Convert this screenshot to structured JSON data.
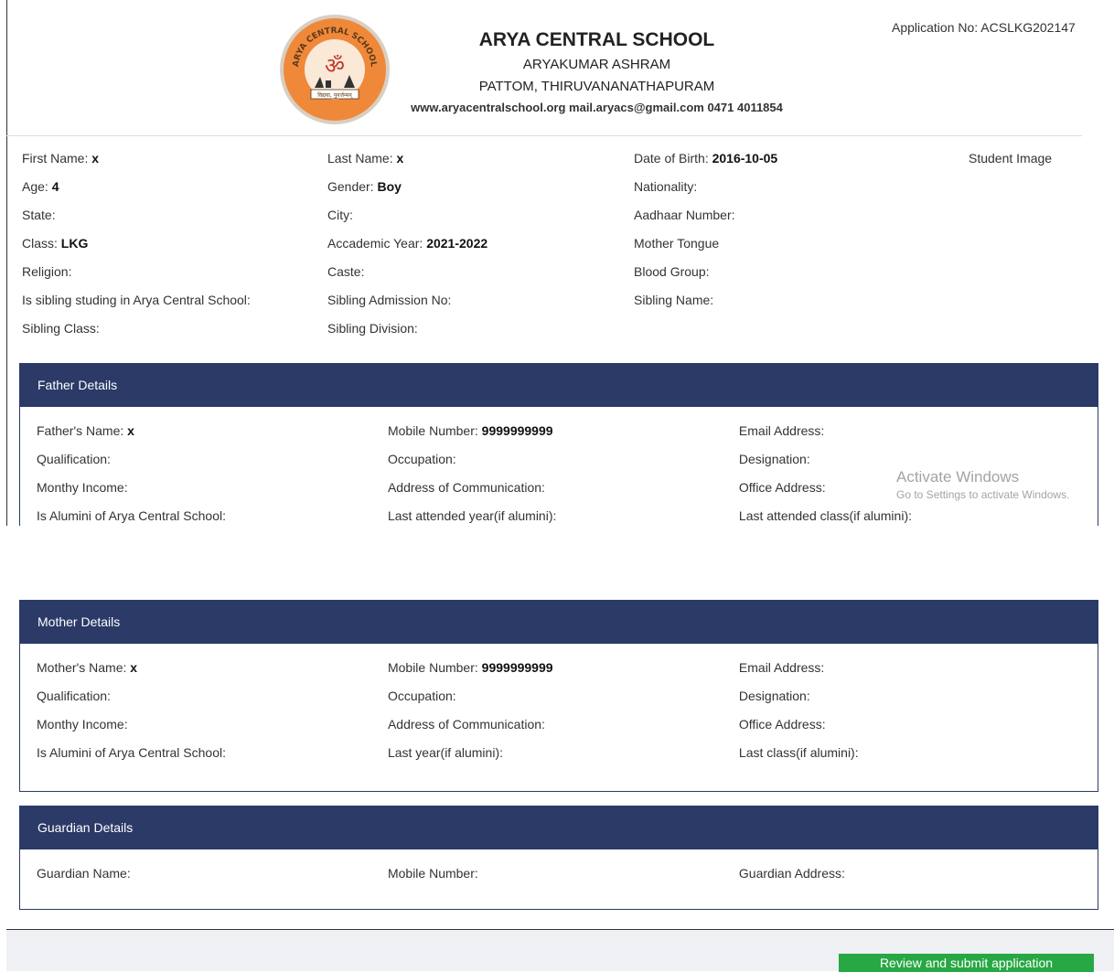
{
  "application": {
    "label": "Application No:",
    "number": "ACSLKG202147"
  },
  "school": {
    "logo_arc_text": "ARYA CENTRAL SCHOOL",
    "logo_motto": "विद्यया, पुनर्जन्मन्",
    "name": "ARYA CENTRAL SCHOOL",
    "line1": "ARYAKUMAR ASHRAM",
    "line2": "PATTOM, THIRUVANANATHAPURAM",
    "contact": "www.aryacentralschool.org mail.aryacs@gmail.com 0471 4011854"
  },
  "student": {
    "rows": [
      [
        {
          "label": "First Name:",
          "value": "x"
        },
        {
          "label": "Last Name:",
          "value": "x"
        },
        {
          "label": "Date of Birth:",
          "value": "2016-10-05"
        },
        {
          "label": "Student Image",
          "value": ""
        }
      ],
      [
        {
          "label": "Age:",
          "value": "4"
        },
        {
          "label": "Gender:",
          "value": "Boy"
        },
        {
          "label": "Nationality:",
          "value": ""
        }
      ],
      [
        {
          "label": "State:",
          "value": ""
        },
        {
          "label": "City:",
          "value": ""
        },
        {
          "label": "Aadhaar Number:",
          "value": ""
        }
      ],
      [
        {
          "label": "Class:",
          "value": "LKG"
        },
        {
          "label": "Accademic Year:",
          "value": "2021-2022"
        },
        {
          "label": "Mother Tongue",
          "value": ""
        }
      ],
      [
        {
          "label": "Religion:",
          "value": ""
        },
        {
          "label": "Caste:",
          "value": ""
        },
        {
          "label": "Blood Group:",
          "value": ""
        }
      ],
      [
        {
          "label": "Is sibling studing in Arya Central School:",
          "value": ""
        },
        {
          "label": "Sibling Admission No:",
          "value": ""
        },
        {
          "label": "Sibling Name:",
          "value": ""
        }
      ],
      [
        {
          "label": "Sibling Class:",
          "value": ""
        },
        {
          "label": "Sibling Division:",
          "value": ""
        }
      ]
    ]
  },
  "father": {
    "title": "Father Details",
    "rows": [
      [
        {
          "label": "Father's Name:",
          "value": "x"
        },
        {
          "label": "Mobile Number:",
          "value": "9999999999"
        },
        {
          "label": "Email Address:",
          "value": ""
        }
      ],
      [
        {
          "label": "Qualification:",
          "value": ""
        },
        {
          "label": "Occupation:",
          "value": ""
        },
        {
          "label": "Designation:",
          "value": ""
        }
      ],
      [
        {
          "label": "Monthy Income:",
          "value": ""
        },
        {
          "label": "Address of Communication:",
          "value": ""
        },
        {
          "label": "Office Address:",
          "value": ""
        }
      ],
      [
        {
          "label": "Is Alumini of Arya Central School:",
          "value": ""
        },
        {
          "label": "Last attended year(if alumini):",
          "value": ""
        },
        {
          "label": "Last attended class(if alumini):",
          "value": ""
        }
      ]
    ]
  },
  "mother": {
    "title": "Mother Details",
    "rows": [
      [
        {
          "label": "Mother's Name:",
          "value": "x"
        },
        {
          "label": "Mobile Number:",
          "value": "9999999999"
        },
        {
          "label": "Email Address:",
          "value": ""
        }
      ],
      [
        {
          "label": "Qualification:",
          "value": ""
        },
        {
          "label": "Occupation:",
          "value": ""
        },
        {
          "label": "Designation:",
          "value": ""
        }
      ],
      [
        {
          "label": "Monthy Income:",
          "value": ""
        },
        {
          "label": "Address of Communication:",
          "value": ""
        },
        {
          "label": "Office Address:",
          "value": ""
        }
      ],
      [
        {
          "label": "Is Alumini of Arya Central School:",
          "value": ""
        },
        {
          "label": "Last year(if alumini):",
          "value": ""
        },
        {
          "label": "Last class(if alumini):",
          "value": ""
        }
      ]
    ]
  },
  "guardian": {
    "title": "Guardian Details",
    "rows": [
      [
        {
          "label": "Guardian Name:",
          "value": ""
        },
        {
          "label": "Mobile Number:",
          "value": ""
        },
        {
          "label": "Guardian Address:",
          "value": ""
        }
      ]
    ]
  },
  "watermark": {
    "title": "Activate Windows",
    "subtitle": "Go to Settings to activate Windows."
  },
  "footer": {
    "submit_label": "Review and submit application"
  },
  "colors": {
    "panel_header": "#2b3a67",
    "submit_button": "#28a745",
    "logo_orange": "#f0883a"
  }
}
